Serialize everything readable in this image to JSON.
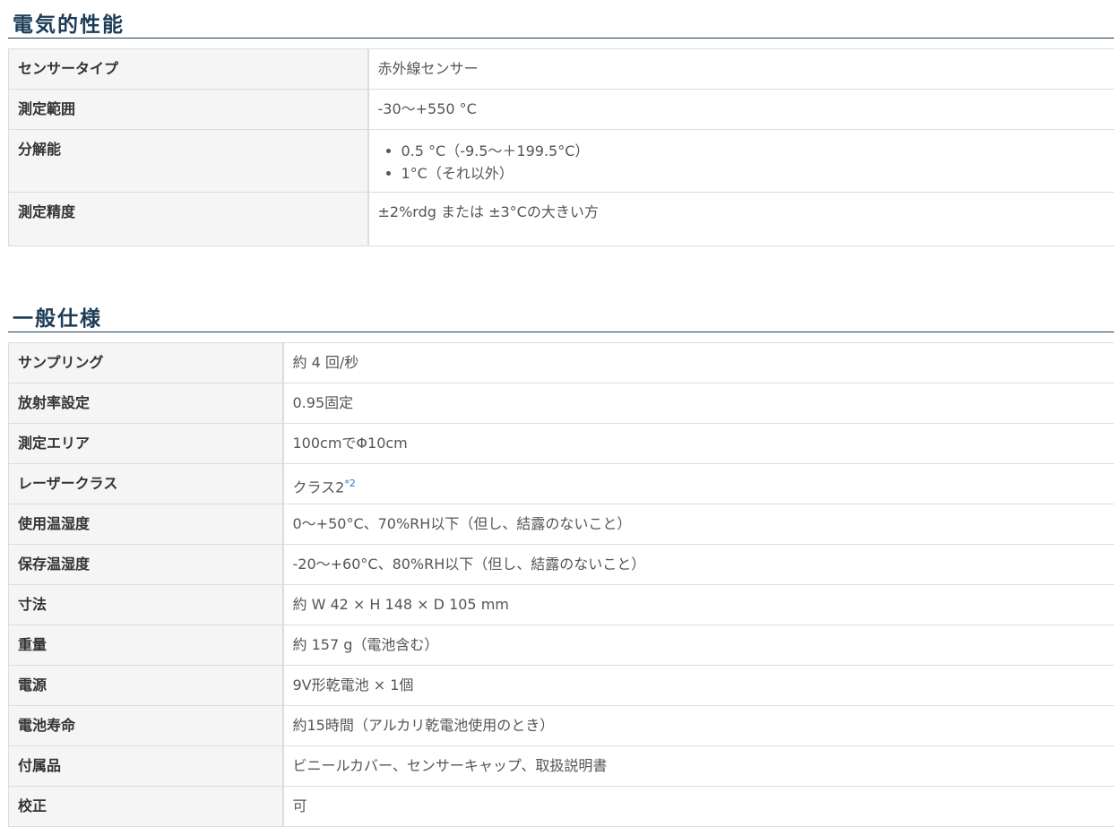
{
  "electrical": {
    "title": "電気的性能",
    "rows": [
      {
        "label": "センサータイプ",
        "value": "赤外線センサー"
      },
      {
        "label": "測定範囲",
        "value": "-30～+550 °C"
      },
      {
        "label": "分解能",
        "items": [
          "0.5 °C（-9.5～＋199.5°C）",
          "1°C（それ以外）"
        ]
      },
      {
        "label": "測定精度",
        "value": "±2%rdg または ±3°Cの大きい方"
      }
    ]
  },
  "general": {
    "title": "一般仕様",
    "rows": [
      {
        "label": "サンプリング",
        "value": "約 4 回/秒"
      },
      {
        "label": "放射率設定",
        "value": "0.95固定"
      },
      {
        "label": "測定エリア",
        "value": "100cmでΦ10cm"
      },
      {
        "label": "レーザークラス",
        "value": "クラス2",
        "note": "*2"
      },
      {
        "label": "使用温湿度",
        "value": "0～+50°C、70%RH以下（但し、結露のないこと）"
      },
      {
        "label": "保存温湿度",
        "value": "-20～+60°C、80%RH以下（但し、結露のないこと）"
      },
      {
        "label": "寸法",
        "value": "約 W 42 × H 148 × D 105 mm"
      },
      {
        "label": "重量",
        "value": "約 157 g（電池含む）"
      },
      {
        "label": "電源",
        "value": "9V形乾電池 × 1個"
      },
      {
        "label": "電池寿命",
        "value": "約15時間（アルカリ乾電池使用のとき）"
      },
      {
        "label": "付属品",
        "value": "ビニールカバー、センサーキャップ、取扱説明書"
      },
      {
        "label": "校正",
        "value": "可"
      }
    ]
  }
}
